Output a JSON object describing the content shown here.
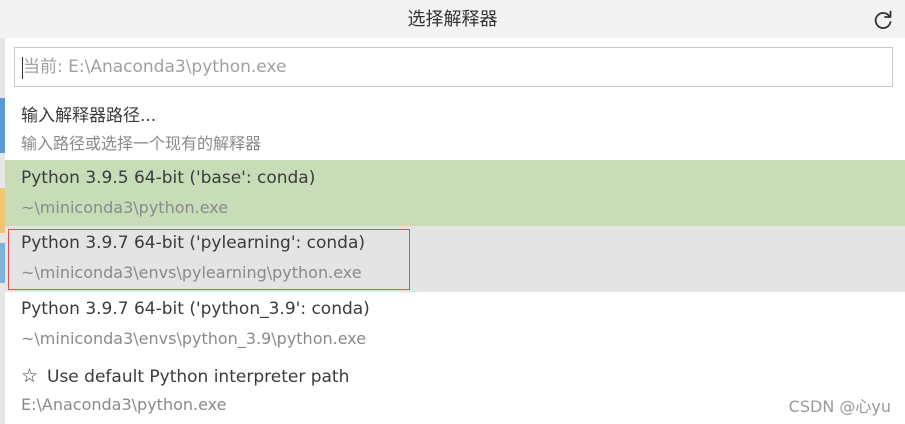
{
  "picker": {
    "title": "选择解释器",
    "refresh_icon": "refresh-icon"
  },
  "search": {
    "placeholder": "当前: E:\\Anaconda3\\python.exe",
    "value": ""
  },
  "items": {
    "enter_path": {
      "label": "输入解释器路径...",
      "detail": "输入路径或选择一个现有的解释器"
    },
    "base": {
      "label": "Python 3.9.5 64-bit ('base': conda)",
      "detail": "~\\miniconda3\\python.exe"
    },
    "pylearning": {
      "label": "Python 3.9.7 64-bit ('pylearning': conda)",
      "detail": "~\\miniconda3\\envs\\pylearning\\python.exe"
    },
    "python39": {
      "label": "Python 3.9.7 64-bit ('python_3.9': conda)",
      "detail": "~\\miniconda3\\envs\\python_3.9\\python.exe"
    },
    "default": {
      "star": "☆",
      "star_icon": "star-icon",
      "label": "Use default Python interpreter path",
      "detail": "E:\\Anaconda3\\python.exe"
    }
  },
  "watermark": "CSDN @心yu",
  "colors": {
    "selected_bg": "#c8ddb7",
    "hover_bg": "#e4e4e4",
    "highlight_border": "#d9534f",
    "titlebar_bg": "#f3f3f3"
  }
}
